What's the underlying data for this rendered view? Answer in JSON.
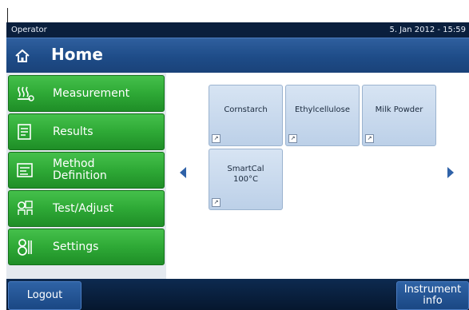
{
  "status_bar": {
    "operator": "Operator",
    "datetime": "5. Jan 2012 - 15:59"
  },
  "header": {
    "title": "Home",
    "icon": "home-icon"
  },
  "menu": [
    {
      "label": "Measurement",
      "icon": "measurement-icon"
    },
    {
      "label": "Results",
      "icon": "results-icon"
    },
    {
      "label": "Method\nDefinition",
      "icon": "method-definition-icon"
    },
    {
      "label": "Test/Adjust",
      "icon": "test-adjust-icon"
    },
    {
      "label": "Settings",
      "icon": "settings-icon"
    }
  ],
  "shortcuts": [
    {
      "label": "Cornstarch"
    },
    {
      "label": "Ethylcellulose"
    },
    {
      "label": "Milk Powder"
    },
    {
      "label": "SmartCal\n100°C"
    }
  ],
  "nav": {
    "left_icon": "left-arrow-icon",
    "right_icon": "right-arrow-icon"
  },
  "footer": {
    "logout": "Logout",
    "instrument_info": "Instrument\ninfo"
  },
  "colors": {
    "menu_green": "#2ea936",
    "header_blue": "#1e4c88",
    "tile_blue": "#c8d9ee",
    "arrow_blue": "#2f62a8"
  }
}
